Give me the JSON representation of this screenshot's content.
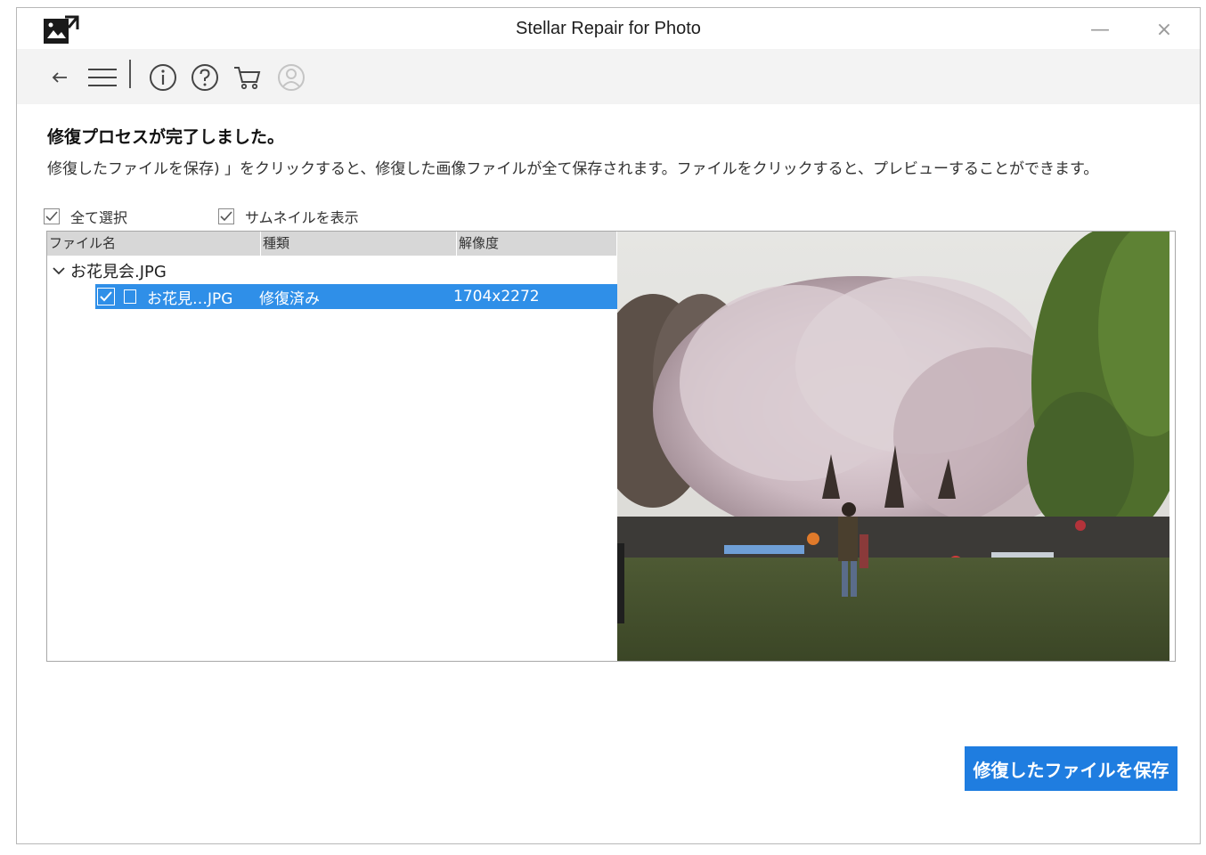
{
  "window": {
    "title": "Stellar Repair for Photo",
    "minimize_glyph": "—",
    "close_glyph": "×"
  },
  "toolbar": {
    "icons": [
      "back-arrow-icon",
      "menu-icon",
      "info-icon",
      "help-icon",
      "cart-icon",
      "user-icon"
    ]
  },
  "content": {
    "heading": "修復プロセスが完了しました。",
    "description": "修復したファイルを保存) 」をクリックすると、修復した画像ファイルが全て保存されます。ファイルをクリックすると、プレビューすることができます。"
  },
  "options": {
    "select_all_label": "全て選択",
    "select_all_checked": true,
    "show_thumbnail_label": "サムネイルを表示",
    "show_thumbnail_checked": true
  },
  "file_list": {
    "columns": [
      "ファイル名",
      "種類",
      "解像度"
    ],
    "group": {
      "name": "お花見会.JPG",
      "expanded": true
    },
    "files": [
      {
        "name": "お花見…JPG",
        "type": "修復済み",
        "resolution": "1704x2272",
        "checked": true,
        "selected": true
      }
    ]
  },
  "save_button_label": "修復したファイルを保存",
  "colors": {
    "accent": "#1f7de0",
    "selection": "#2f8fe8",
    "toolbar_bg": "#f3f3f3",
    "header_bg": "#d7d7d7"
  }
}
